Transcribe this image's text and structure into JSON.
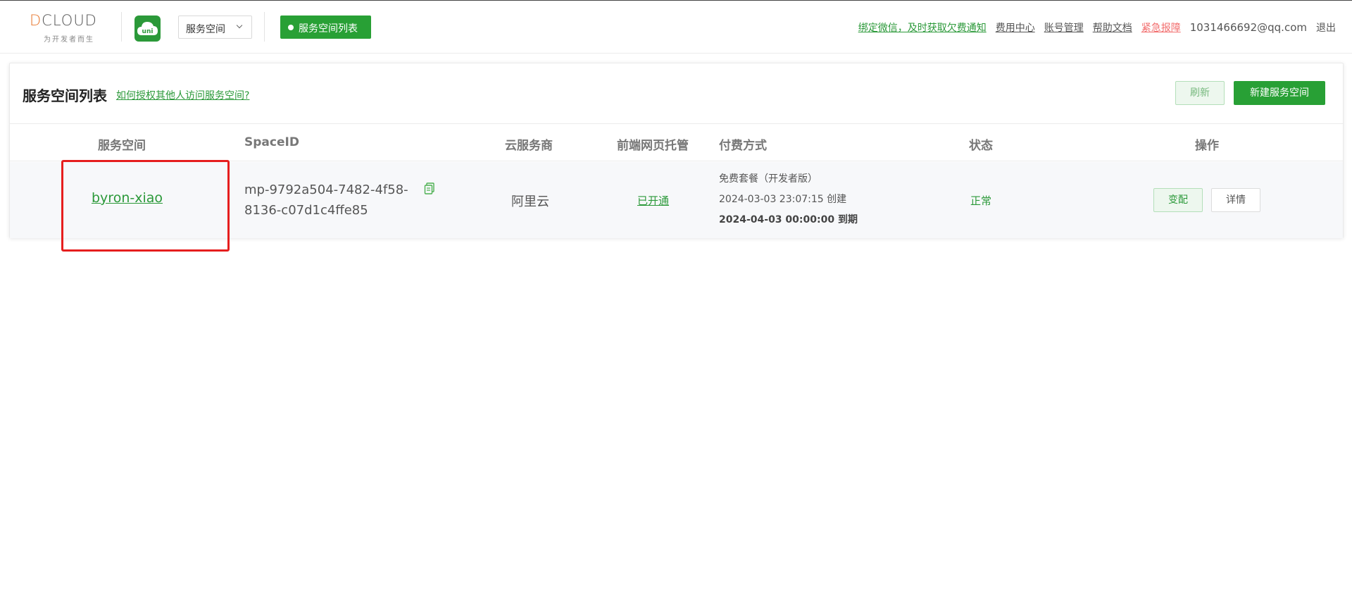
{
  "header": {
    "logo_text": "DCLOUD",
    "logo_tagline": "为开发者而生",
    "app_icon_label": "uni",
    "space_select": {
      "value": "服务空间"
    },
    "active_nav": "服务空间列表",
    "links": {
      "wechat_bind": "绑定微信，及时获取欠费通知",
      "billing": "费用中心",
      "account": "账号管理",
      "docs": "帮助文档",
      "emergency": "紧急报障",
      "email": "1031466692@qq.com",
      "logout": "退出"
    }
  },
  "card": {
    "title": "服务空间列表",
    "help_link": "如何授权其他人访问服务空间?",
    "refresh_label": "刷新",
    "new_label": "新建服务空间",
    "columns": [
      "服务空间",
      "SpaceID",
      "云服务商",
      "前端网页托管",
      "付费方式",
      "状态",
      "操作"
    ],
    "rows": [
      {
        "name": "byron-xiao",
        "space_id_line1": "mp-9792a504-7482-4f58-",
        "space_id_line2": "8136-c07d1c4ffe85",
        "provider": "阿里云",
        "hosting": "已开通",
        "plan": "免费套餐（开发者版）",
        "created": "2024-03-03 23:07:15 创建",
        "expires": "2024-04-03 00:00:00 到期",
        "status": "正常",
        "action_config": "变配",
        "action_detail": "详情"
      }
    ]
  },
  "colors": {
    "brand_green": "#28a035",
    "link_green": "#2b9939",
    "alert_red": "#f26d6d",
    "highlight_red": "#e61e1e",
    "logo_orange": "#e8772e"
  }
}
